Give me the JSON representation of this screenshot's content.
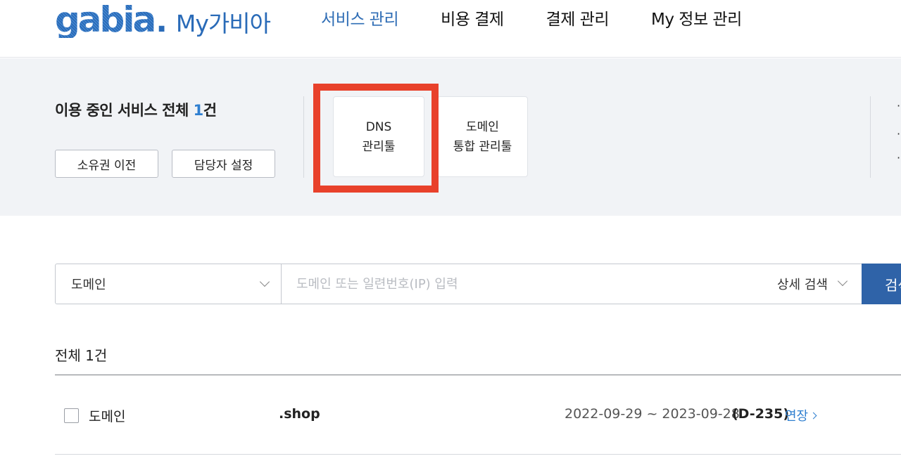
{
  "header": {
    "logo_word": "gabia",
    "logo_dot": ".",
    "logo_sub": "My가비아",
    "nav": [
      {
        "label": "서비스 관리",
        "active": true
      },
      {
        "label": "비용 결제",
        "active": false
      },
      {
        "label": "결제 관리",
        "active": false
      },
      {
        "label": "My 정보 관리",
        "active": false
      }
    ]
  },
  "summary": {
    "title_prefix": "이용 중인 서비스 전체 ",
    "count": "1",
    "title_suffix": "건",
    "transfer_button": "소유권 이전",
    "contact_button": "담당자 설정",
    "tools": [
      {
        "line1": "DNS",
        "line2": "관리툴"
      },
      {
        "line1": "도메인",
        "line2": "통합 관리툴"
      }
    ]
  },
  "search": {
    "category": "도메인",
    "placeholder": "도메인 또는 일련번호(IP) 입력",
    "detail_label": "상세 검색",
    "button_label": "검색"
  },
  "list": {
    "total_label": "전체 1건",
    "rows": [
      {
        "type": "도메인",
        "name": ".shop",
        "period": "2022-09-29 ~ 2023-09-28",
        "dday": "(D-235)",
        "extend_label": "연장"
      }
    ]
  },
  "colors": {
    "accent": "#2f6db5",
    "highlight_box": "#e8412b",
    "search_button": "#2f63a8",
    "panel_bg": "#f1f3f6"
  }
}
